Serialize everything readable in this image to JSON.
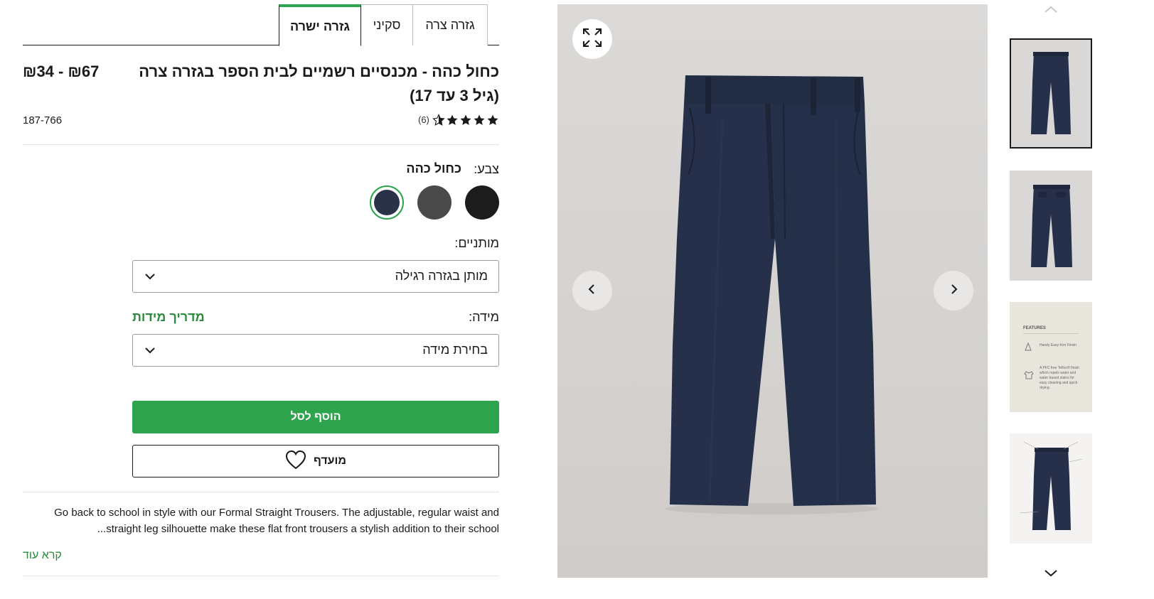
{
  "tabs": [
    {
      "label": "גזרה צרה"
    },
    {
      "label": "סקיני"
    },
    {
      "label": "גזרה ישרה"
    }
  ],
  "product": {
    "title": "כחול כהה - מכנסיים רשמיים לבית הספר בגזרה צרה (גיל 3 עד 17)",
    "price": "₪34 - ₪67",
    "rating": 4.5,
    "review_count": "(6)",
    "sku": "187-766"
  },
  "color": {
    "label": "צבע:",
    "selected": "כחול כהה",
    "swatches": [
      {
        "name": "black",
        "hex": "#1c1c1c"
      },
      {
        "name": "grey",
        "hex": "#4a4a4a"
      },
      {
        "name": "navy",
        "hex": "#2a3248",
        "selected": true
      }
    ]
  },
  "waist": {
    "label": "מותניים:",
    "value": "מותן בגזרה רגילה"
  },
  "size": {
    "label": "מידה:",
    "guide": "מדריך מידות",
    "placeholder": "בחירת מידה"
  },
  "buttons": {
    "add_to_cart": "הוסף לסל",
    "favourite": "מועדף"
  },
  "description": {
    "text": "Go back to school in style with our Formal Straight Trousers. The adjustable, regular waist and straight leg silhouette make these flat front trousers a stylish addition to their school...",
    "read_more": "קרא עוד"
  },
  "colors": {
    "accent_green": "#2ea44f",
    "link_green": "#2b8a3e",
    "trouser_navy": "#24304a",
    "image_bg": "#d9d7d5"
  },
  "icons": {
    "expand": "expand-icon",
    "prev": "chevron-left-icon",
    "next": "chevron-right-icon",
    "heart": "heart-icon",
    "thumbs_up": "chevron-up-icon",
    "thumbs_down": "chevron-down-icon"
  },
  "thumbnail_features": {
    "heading": "FEATURES",
    "line1": "Handy Easy-Iron Finish",
    "line2": "A PFC free Teflon® finish which repels water and water based stains for easy cleaning and quick drying."
  }
}
